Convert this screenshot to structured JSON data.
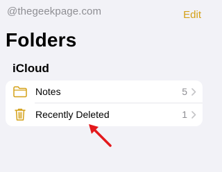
{
  "watermark": "@thegeekpage.com",
  "nav": {
    "edit_label": "Edit"
  },
  "page_title": "Folders",
  "section": {
    "title": "iCloud",
    "folders": [
      {
        "name": "Notes",
        "count": "5",
        "icon": "folder-icon"
      },
      {
        "name": "Recently Deleted",
        "count": "1",
        "icon": "trash-icon"
      }
    ]
  },
  "colors": {
    "accent": "#d4a017",
    "background": "#f2f2f7",
    "card": "#ffffff",
    "secondary_text": "#8e8e93",
    "annotation_arrow": "#e3191c"
  }
}
